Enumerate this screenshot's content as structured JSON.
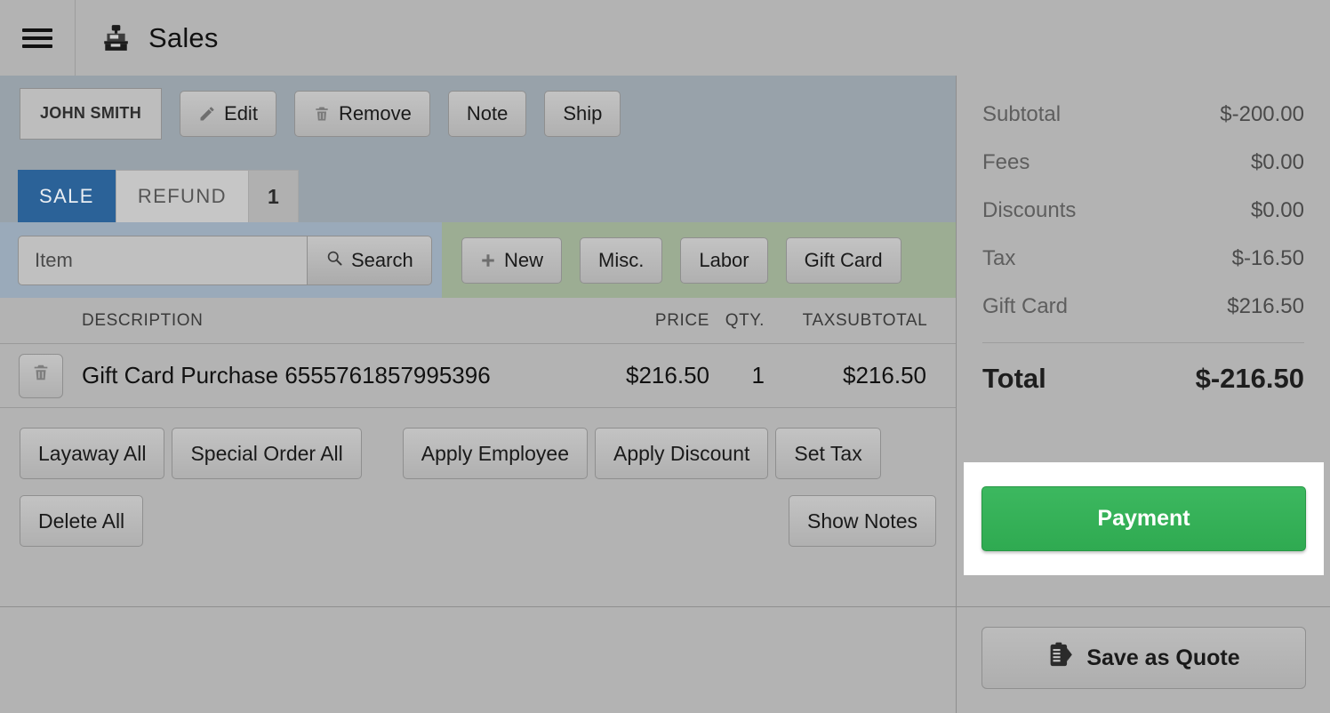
{
  "header": {
    "menu_icon": "hamburger-menu-icon",
    "app_icon": "cash-register-icon",
    "title": "Sales"
  },
  "toolbar": {
    "customer_name": "JOHN SMITH",
    "edit_label": "Edit",
    "edit_icon": "pencil-icon",
    "remove_label": "Remove",
    "remove_icon": "trash-icon",
    "note_label": "Note",
    "ship_label": "Ship"
  },
  "tabs": {
    "sale_label": "SALE",
    "refund_label": "REFUND",
    "refund_badge": "1"
  },
  "search": {
    "placeholder": "Item",
    "value": "",
    "search_label": "Search",
    "search_icon": "magnifier-icon"
  },
  "item_actions": {
    "new_label": "New",
    "new_icon": "plus-icon",
    "misc_label": "Misc.",
    "labor_label": "Labor",
    "gift_card_label": "Gift Card"
  },
  "line_items": {
    "columns": {
      "description": "DESCRIPTION",
      "price": "PRICE",
      "qty": "QTY.",
      "tax": "TAX",
      "subtotal": "SUBTOTAL"
    },
    "rows": [
      {
        "delete_icon": "trash-icon",
        "description": "Gift Card Purchase 6555761857995396",
        "price": "$216.50",
        "qty": "1",
        "tax": "",
        "subtotal": "$216.50"
      }
    ]
  },
  "bulk_actions": {
    "layaway_all": "Layaway All",
    "special_order_all": "Special Order All",
    "apply_employee": "Apply Employee",
    "apply_discount": "Apply Discount",
    "set_tax": "Set Tax",
    "delete_all": "Delete All",
    "show_notes": "Show Notes"
  },
  "summary": {
    "lines": [
      {
        "label": "Subtotal",
        "value": "$-200.00"
      },
      {
        "label": "Fees",
        "value": "$0.00"
      },
      {
        "label": "Discounts",
        "value": "$0.00"
      },
      {
        "label": "Tax",
        "value": "$-16.50"
      },
      {
        "label": "Gift Card",
        "value": "$216.50"
      }
    ],
    "total_label": "Total",
    "total_value": "$-216.50"
  },
  "footer": {
    "payment_label": "Payment",
    "save_quote_label": "Save as Quote",
    "save_quote_icon": "quote-clipboard-icon"
  },
  "colors": {
    "payment_green": "#35b158",
    "tab_active_blue": "#2b6298",
    "toolbar_band": "#98a2aa",
    "search_band_left": "#9aaaba",
    "search_band_right": "#9cad93",
    "page_background": "#b3b3b3"
  }
}
